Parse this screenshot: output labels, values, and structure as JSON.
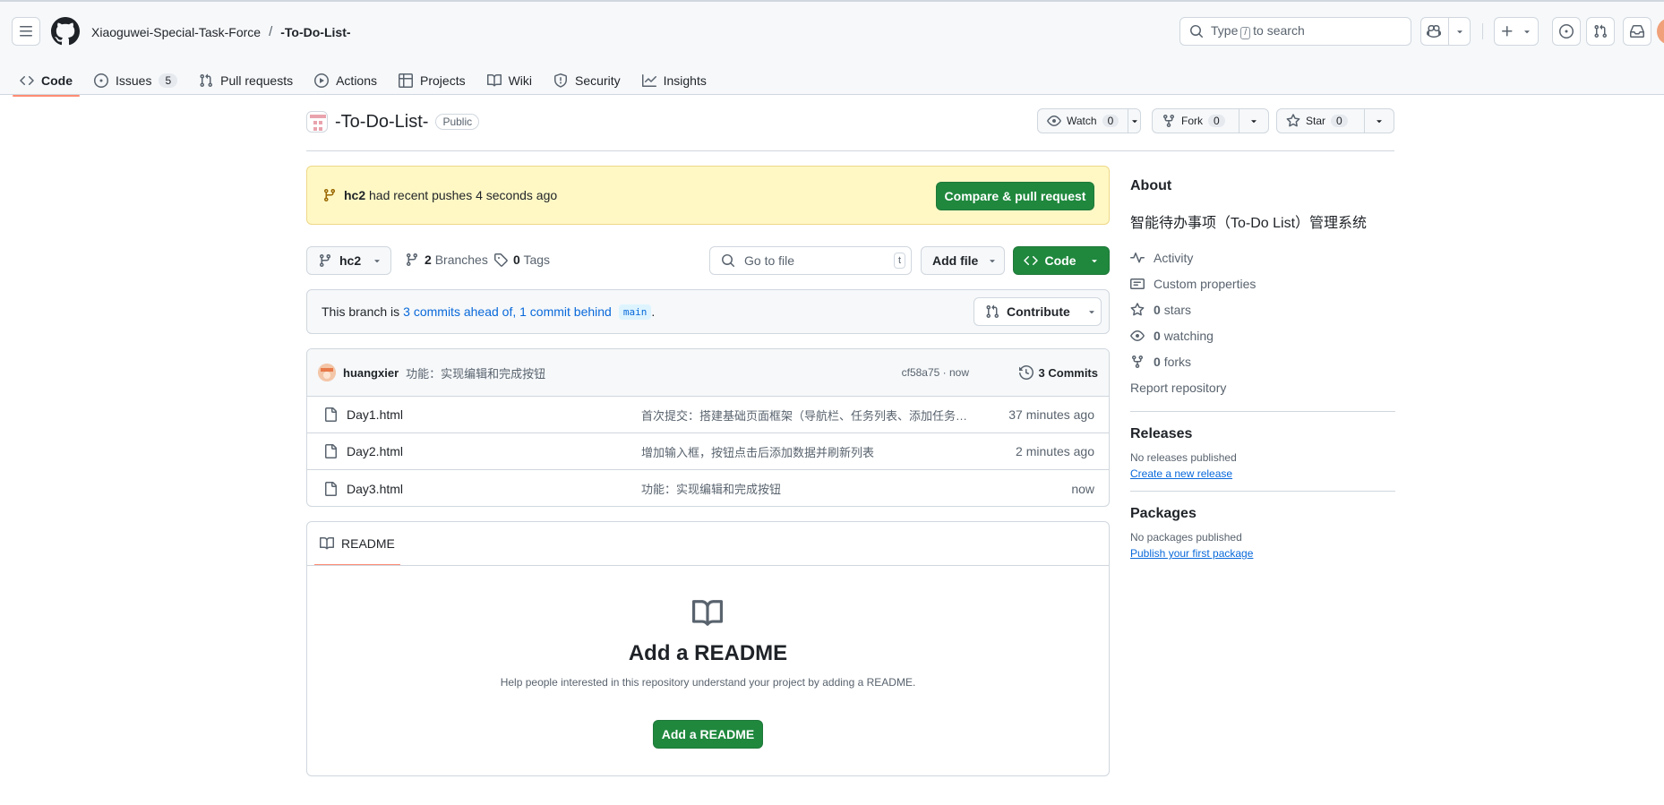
{
  "header": {
    "owner": "Xiaoguwei-Special-Task-Force",
    "separator": "/",
    "repo": "-To-Do-List-",
    "search_prefix": "Type",
    "search_key": "/",
    "search_suffix": "to search"
  },
  "tabs": [
    {
      "label": "Code",
      "icon": "code-icon"
    },
    {
      "label": "Issues",
      "icon": "issue-icon",
      "count": "5"
    },
    {
      "label": "Pull requests",
      "icon": "pull-request-icon"
    },
    {
      "label": "Actions",
      "icon": "play-icon"
    },
    {
      "label": "Projects",
      "icon": "table-icon"
    },
    {
      "label": "Wiki",
      "icon": "book-icon"
    },
    {
      "label": "Security",
      "icon": "shield-icon"
    },
    {
      "label": "Insights",
      "icon": "graph-icon"
    }
  ],
  "repo": {
    "name": "-To-Do-List-",
    "visibility": "Public",
    "watch_label": "Watch",
    "watch_count": "0",
    "fork_label": "Fork",
    "fork_count": "0",
    "star_label": "Star",
    "star_count": "0"
  },
  "flash": {
    "branch": "hc2",
    "text": "had recent pushes 4 seconds ago",
    "button": "Compare & pull request"
  },
  "branchbar": {
    "branch": "hc2",
    "branches_count": "2",
    "branches_label": "Branches",
    "tags_count": "0",
    "tags_label": "Tags",
    "goto_placeholder": "Go to file",
    "goto_key": "t",
    "addfile_label": "Add file",
    "code_label": "Code"
  },
  "status": {
    "prefix": "This branch is",
    "link": "3 commits ahead of, 1 commit behind",
    "base": "main",
    "suffix": ".",
    "contribute": "Contribute"
  },
  "commit": {
    "author": "huangxier",
    "message": "功能：实现编辑和完成按钮",
    "meta": "cf58a75 · now",
    "count": "3 Commits"
  },
  "files": [
    {
      "name": "Day1.html",
      "message": "首次提交：搭建基础页面框架（导航栏、任务列表、添加任务…",
      "time": "37 minutes ago"
    },
    {
      "name": "Day2.html",
      "message": "增加输入框，按钮点击后添加数据并刷新列表",
      "time": "2 minutes ago"
    },
    {
      "name": "Day3.html",
      "message": "功能：实现编辑和完成按钮",
      "time": "now"
    }
  ],
  "readme": {
    "tab": "README",
    "heading": "Add a README",
    "text": "Help people interested in this repository understand your project by adding a README.",
    "button": "Add a README"
  },
  "sidebar": {
    "about_title": "About",
    "description": "智能待办事项（To-Do List）管理系统",
    "activity": "Activity",
    "custom_properties": "Custom properties",
    "stars_count": "0",
    "stars_label": "stars",
    "watching_count": "0",
    "watching_label": "watching",
    "forks_count": "0",
    "forks_label": "forks",
    "report": "Report repository",
    "releases_title": "Releases",
    "releases_none": "No releases published",
    "releases_link": "Create a new release",
    "packages_title": "Packages",
    "packages_none": "No packages published",
    "packages_link": "Publish your first package"
  },
  "colors": {
    "green": "#1f883d",
    "link": "#0969da",
    "tab_underline": "#fd8c73",
    "flash_bg": "#fff8c5"
  }
}
